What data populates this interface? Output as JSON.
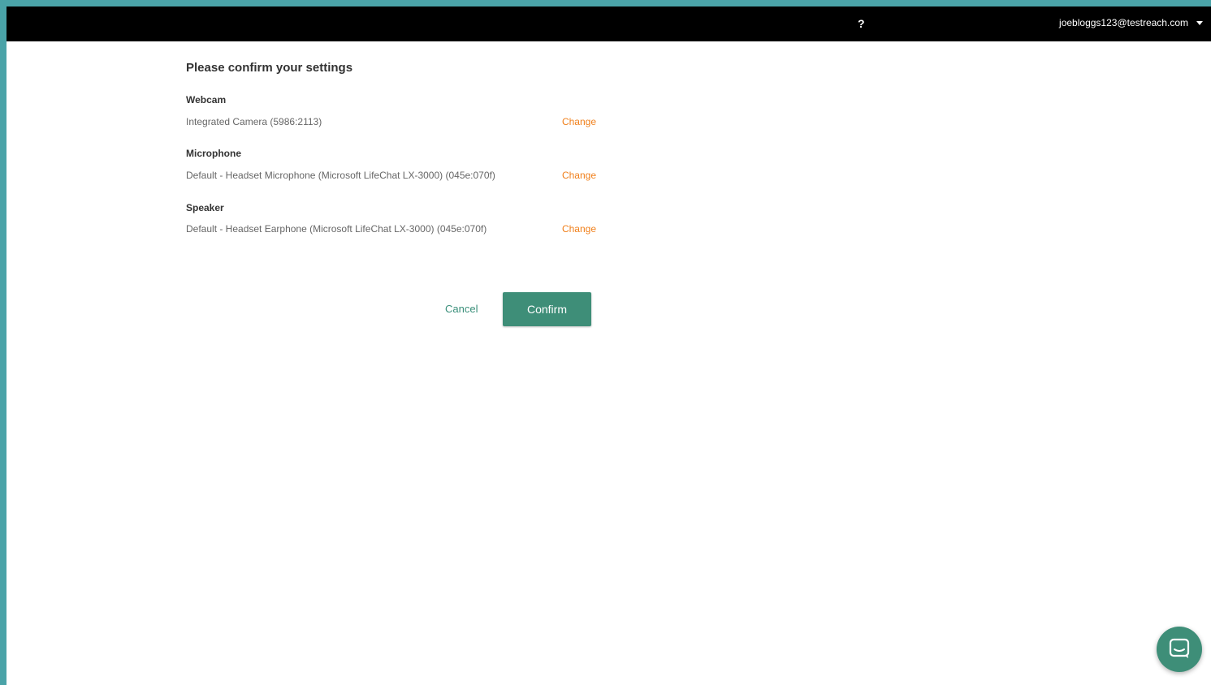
{
  "header": {
    "help_label": "?",
    "user_email": "joebloggs123@testreach.com"
  },
  "main": {
    "title": "Please confirm your settings",
    "settings": [
      {
        "label": "Webcam",
        "value": "Integrated Camera (5986:2113)",
        "change_label": "Change"
      },
      {
        "label": "Microphone",
        "value": "Default - Headset Microphone (Microsoft LifeChat LX-3000) (045e:070f)",
        "change_label": "Change"
      },
      {
        "label": "Speaker",
        "value": "Default - Headset Earphone (Microsoft LifeChat LX-3000) (045e:070f)",
        "change_label": "Change"
      }
    ],
    "cancel_label": "Cancel",
    "confirm_label": "Confirm"
  },
  "colors": {
    "frame_border": "#4aa3a8",
    "topbar": "#000000",
    "accent_green": "#3e8e78",
    "change_orange": "#f07f1a"
  },
  "icons": {
    "help": "question-mark-icon",
    "user_menu": "chevron-down-icon",
    "chat": "chat-bubble-icon"
  }
}
